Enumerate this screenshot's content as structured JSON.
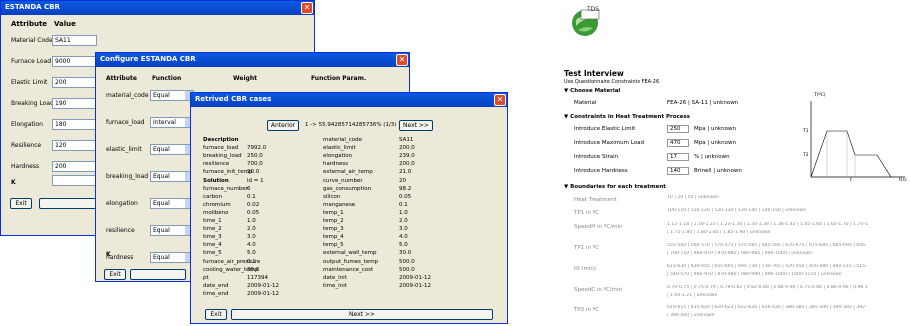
{
  "w1": {
    "title": "ESTANDA CBR",
    "col1": "Attribute",
    "col2": "Value",
    "rows": [
      {
        "label": "Material Code",
        "value": "SA11"
      },
      {
        "label": "Furnace Load",
        "value": "9000"
      },
      {
        "label": "Elastic Limit",
        "value": "200"
      },
      {
        "label": "Breaking Load",
        "value": "190"
      },
      {
        "label": "Elongation",
        "value": "180"
      },
      {
        "label": "Resilience",
        "value": "120"
      },
      {
        "label": "Hardness",
        "value": "200"
      }
    ],
    "k": "K",
    "exit": "Exit"
  },
  "w2": {
    "title": "Configure ESTANDA CBR",
    "col1": "Attribute",
    "col2": "Function",
    "col3": "Weight",
    "col4": "Function Param.",
    "rows": [
      {
        "label": "material_code",
        "func": "Equal"
      },
      {
        "label": "furnace_load",
        "func": "Interval"
      },
      {
        "label": "elastic_limit",
        "func": "Equal"
      },
      {
        "label": "breaking_load",
        "func": "Equal"
      },
      {
        "label": "elongation",
        "func": "Equal"
      },
      {
        "label": "resilience",
        "func": "Equal"
      },
      {
        "label": "hardness",
        "func": "Equal"
      }
    ],
    "k": "K",
    "exit": "Exit"
  },
  "w3": {
    "title": "Retrived CBR cases",
    "prev": "Anterior",
    "info": "1 -> 55.94285714285736% (1/3)",
    "next": "Siguiente",
    "left": [
      [
        "Description",
        "",
        "b"
      ],
      [
        "furnace_load",
        "7992.0",
        ""
      ],
      [
        "breaking_load",
        "250.0",
        ""
      ],
      [
        "resilience",
        "700.0",
        ""
      ],
      [
        "furnace_init_temp",
        "20.0",
        ""
      ],
      [
        "Solution",
        "id = 1",
        "b"
      ],
      [
        "furnace_number",
        "6",
        ""
      ],
      [
        "carbon",
        "0.1",
        ""
      ],
      [
        "chromium",
        "0.02",
        ""
      ],
      [
        "molibeno",
        "0.05",
        ""
      ],
      [
        "time_1",
        "1.0",
        ""
      ],
      [
        "time_2",
        "2.0",
        ""
      ],
      [
        "time_3",
        "3.0",
        ""
      ],
      [
        "time_4",
        "4.0",
        ""
      ],
      [
        "time_5",
        "5.0",
        ""
      ],
      [
        "furnace_air_pressure",
        "0.1",
        ""
      ],
      [
        "cooling_water_temp",
        "30.0",
        ""
      ],
      [
        "pt",
        "117394",
        ""
      ],
      [
        "date_end",
        "2009-01-12",
        ""
      ],
      [
        "time_end",
        "2009-01-12",
        ""
      ]
    ],
    "right": [
      [
        "material_code",
        "SA11"
      ],
      [
        "elastic_limit",
        "200.0"
      ],
      [
        "elongation",
        "239.0"
      ],
      [
        "hardness",
        "200.0"
      ],
      [
        "external_air_temp",
        "21.0"
      ],
      [
        "curve_number",
        "20"
      ],
      [
        "gas_consumption",
        "98.2"
      ],
      [
        "silicon",
        "0.05"
      ],
      [
        "manganese",
        "0.1"
      ],
      [
        "temp_1",
        "1.0"
      ],
      [
        "temp_2",
        "2.0"
      ],
      [
        "temp_3",
        "3.0"
      ],
      [
        "temp_4",
        "4.0"
      ],
      [
        "temp_5",
        "5.0"
      ],
      [
        "external_wall_temp",
        "30.0"
      ],
      [
        "output_fumes_temp",
        "500.0"
      ],
      [
        "maintenance_cost",
        "500.0"
      ],
      [
        "date_init",
        "2009-01-12"
      ],
      [
        "time_init",
        "2009-01-12"
      ]
    ],
    "exit": "Exit",
    "nextbtn": "Next >>"
  },
  "ti": {
    "logo": "TDS",
    "title": "Test Interview",
    "subtitle": "Use Questionnaire Constraints FEA-26",
    "s1": "Choose Material",
    "mat_label": "Material",
    "mat_value": "FEA-26 | SA-11 | unknown",
    "s2": "Constraints in Heat Treatment Process",
    "c": [
      {
        "label": "Introduce Elastic Limit",
        "val": "250",
        "unit": "Mpa | unknown"
      },
      {
        "label": "Introduce Maximum Load",
        "val": "470",
        "unit": "Mpa | unknown"
      },
      {
        "label": "Introduce Strain",
        "val": "17",
        "unit": "% | unknown"
      },
      {
        "label": "Introduce Hardness",
        "val": "140",
        "unit": "Brinell | unknown"
      }
    ],
    "s3": "Boundaries for each treatment",
    "b": [
      {
        "label": "Heat Treatment",
        "opts": [
          "10 | 20 | 50 | unknown"
        ]
      },
      {
        "label": "TP1 in ºC",
        "opts": [
          "100-110 | 110-120 | 120-130 | 130-140 | 140-150 | unknown"
        ]
      },
      {
        "label": "SpeedH in ºC/min",
        "opts": [
          "1.12-1.18 | 1.18-1.23 | 1.23-1.30 | 1.30-1.38 | 1.38-1.45 | 1.45-1.60 | 1.60-1.70 | 1.70-1",
          "| 1.75-1.80 | 1.80-1.85 | 1.85-1.90 | unknown"
        ]
      },
      {
        "label": "TP1 in ºC",
        "opts": [
          "555-560 | 560-570 | 570-575 | 575-585 | 585-595 | 670-675 | 675-685 | 685-695 | 695-",
          "| 700-710 | 960-970 | 970-980 | 980-985 | 995-1000 | unknown"
        ]
      },
      {
        "label": "t0 (min)",
        "opts": [
          "615-630 | 630-655 | 655-695 | 695-730 | 730-765 | 420-450 | 450-480 | 480-515 | 515-",
          "| 540-570 | 960-970 | 970-980 | 980-990 | 990-1000 | 1000-1110 | unknown"
        ]
      },
      {
        "label": "SpeedC in ºC/min",
        "opts": [
          "0.70-0.75 | 0.75-0.79 | 0.79-0.82 | 0.82-0.86 | 0.86-0.90 | 0.75-0.86 | 0.86-0.96 | 0.96-1",
          "| 1.00-1.21 | unknown"
        ]
      },
      {
        "label": "TP3 in ºC",
        "opts": [
          "610-615 | 615-620 | 620-622 | 622-626 | 626-630 | 380-385 | 385-390 | 390-392 | 392-",
          "| 396-400 | unknown"
        ]
      }
    ],
    "graph": {
      "ylabel": "T(ºC)",
      "t1": "T1",
      "t2": "T2",
      "tlabel": "t",
      "xlabel": "t(s)"
    }
  },
  "colors": {
    "title": "#0a4fd6",
    "close": "#e04a2a",
    "face": "#ece9d8"
  }
}
